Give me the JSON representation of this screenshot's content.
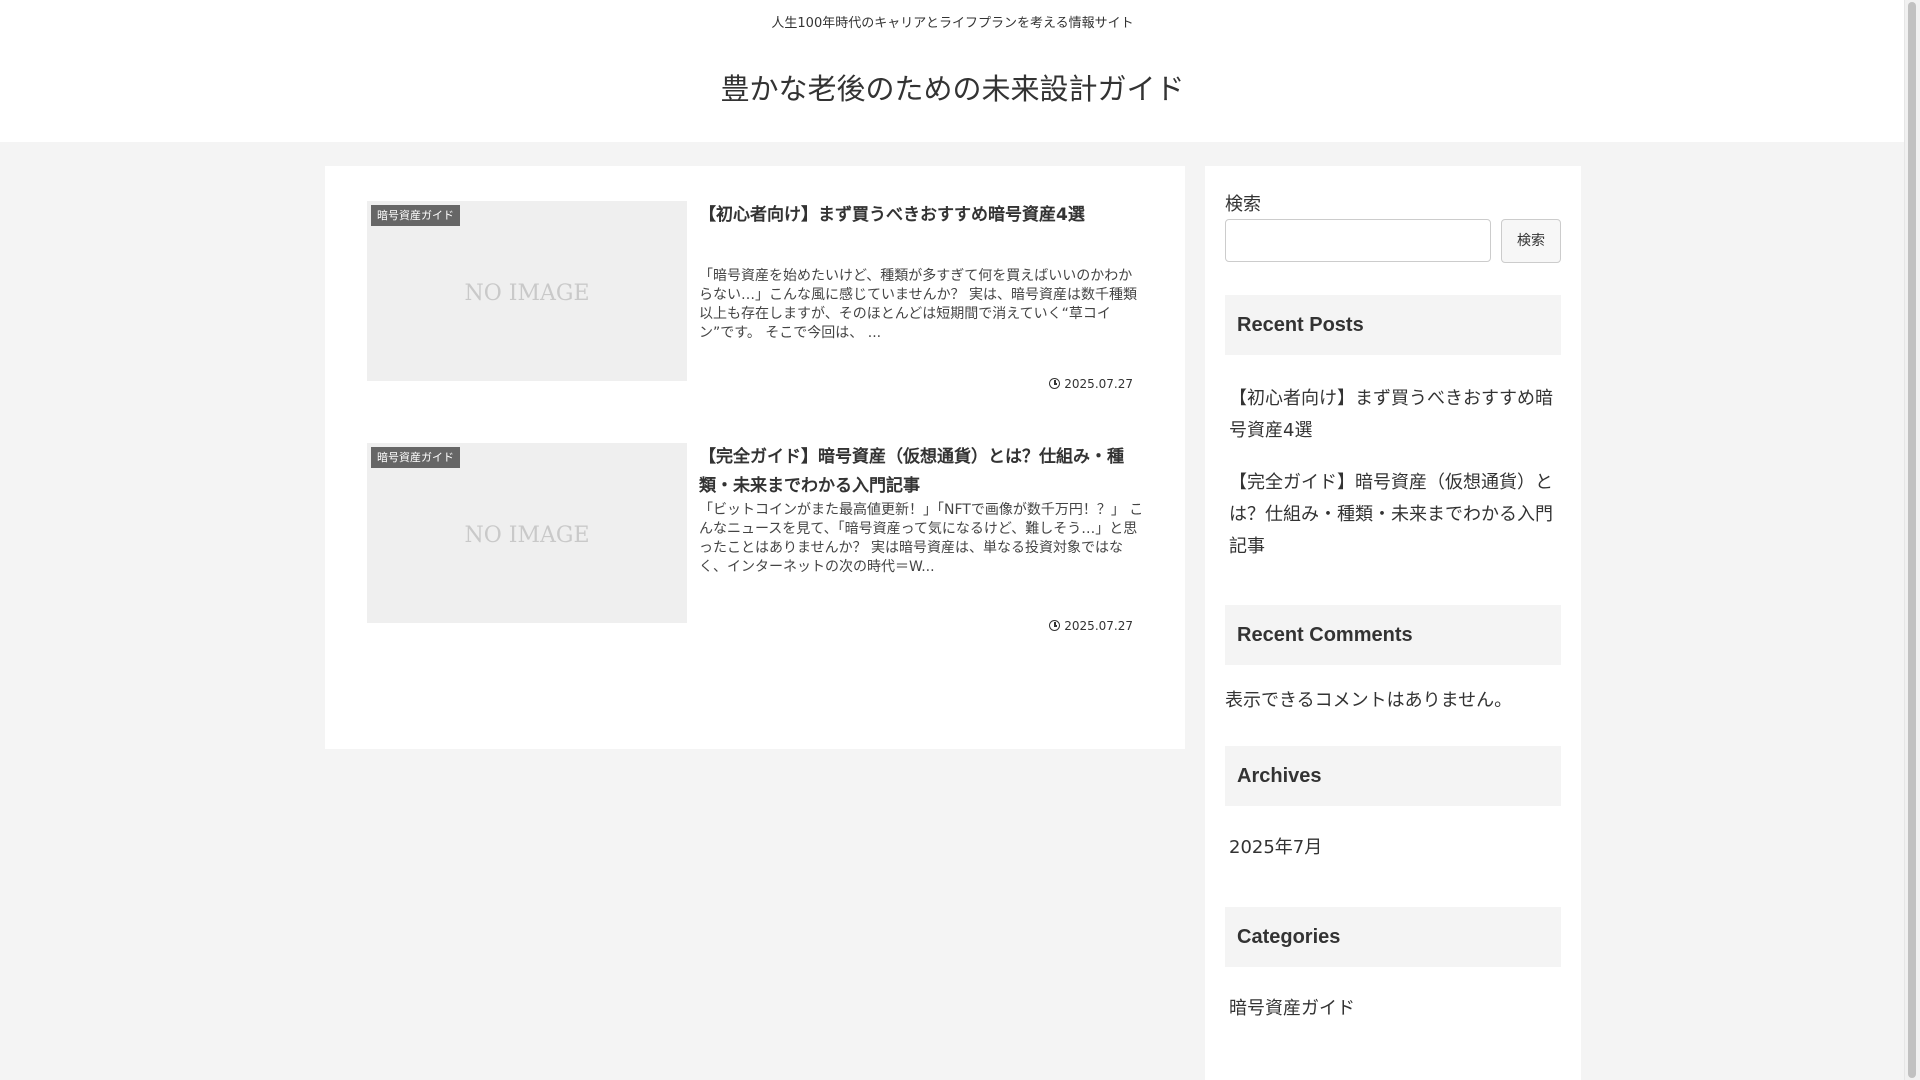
{
  "header": {
    "tagline": "人生100年時代のキャリアとライフプランを考える情報サイト",
    "site_title": "豊かな老後のための未来設計ガイド"
  },
  "posts": [
    {
      "category": "暗号資産ガイド",
      "thumbnail_text": "NO IMAGE",
      "title": "【初心者向け】まず買うべきおすすめ暗号資産4選",
      "snippet": "「暗号資産を始めたいけど、種類が多すぎて何を買えばいいのかわからない…」こんな風に感じていませんか？ 実は、暗号資産は数千種類以上も存在しますが、そのほとんどは短期間で消えていく“草コイン”です。 そこで今回は、 ...",
      "date": "2025.07.27",
      "date_icon": "clock-icon"
    },
    {
      "category": "暗号資産ガイド",
      "thumbnail_text": "NO IMAGE",
      "title": "【完全ガイド】暗号資産（仮想通貨）とは？仕組み・種類・未来までわかる入門記事",
      "snippet": "「ビットコインがまた最高値更新！」「NFTで画像が数千万円！？」 こんなニュースを見て、「暗号資産って気になるけど、難しそう…」と思ったことはありませんか？ 実は暗号資産は、単なる投資対象ではなく、インターネットの次の時代＝W...",
      "date": "2025.07.27",
      "date_icon": "clock-icon"
    }
  ],
  "sidebar": {
    "search": {
      "label": "検索",
      "placeholder": "",
      "button": "検索"
    },
    "recent_posts": {
      "heading": "Recent Posts",
      "items": [
        "【初心者向け】まず買うべきおすすめ暗号資産4選",
        "【完全ガイド】暗号資産（仮想通貨）とは？仕組み・種類・未来までわかる入門記事"
      ]
    },
    "recent_comments": {
      "heading": "Recent Comments",
      "empty_text": "表示できるコメントはありません。"
    },
    "archives": {
      "heading": "Archives",
      "items": [
        "2025年7月"
      ]
    },
    "categories": {
      "heading": "Categories",
      "items": [
        "暗号資産ガイド"
      ]
    }
  },
  "colors": {
    "page_background": "#f4f4f4",
    "card_background": "#ffffff",
    "category_badge": "#666666",
    "thumbnail_background": "#efefef"
  }
}
